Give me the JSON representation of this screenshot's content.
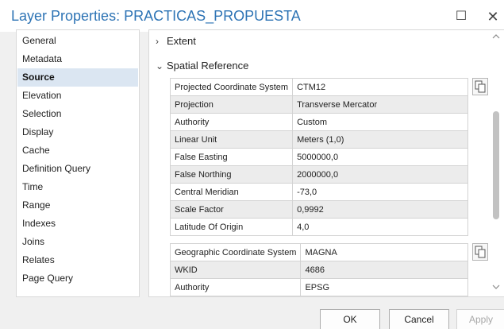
{
  "window": {
    "title": "Layer Properties: PRACTICAS_PROPUESTA",
    "max_glyph": "☐",
    "close_glyph": "✕"
  },
  "sidebar": {
    "items": [
      {
        "label": "General"
      },
      {
        "label": "Metadata"
      },
      {
        "label": "Source",
        "selected": true
      },
      {
        "label": "Elevation"
      },
      {
        "label": "Selection"
      },
      {
        "label": "Display"
      },
      {
        "label": "Cache"
      },
      {
        "label": "Definition Query"
      },
      {
        "label": "Time"
      },
      {
        "label": "Range"
      },
      {
        "label": "Indexes"
      },
      {
        "label": "Joins"
      },
      {
        "label": "Relates"
      },
      {
        "label": "Page Query"
      }
    ]
  },
  "main": {
    "extent": {
      "label": "Extent",
      "expanded": false,
      "chevron": "›"
    },
    "spatial_reference": {
      "label": "Spatial Reference",
      "expanded": true,
      "chevron": "⌄"
    },
    "projected": [
      {
        "key": "Projected Coordinate System",
        "value": "CTM12"
      },
      {
        "key": "Projection",
        "value": "Transverse Mercator"
      },
      {
        "key": "Authority",
        "value": "Custom"
      },
      {
        "key": "Linear Unit",
        "value": "Meters (1,0)"
      },
      {
        "key": "False Easting",
        "value": "5000000,0"
      },
      {
        "key": "False Northing",
        "value": "2000000,0"
      },
      {
        "key": "Central Meridian",
        "value": "-73,0"
      },
      {
        "key": "Scale Factor",
        "value": "0,9992"
      },
      {
        "key": "Latitude Of Origin",
        "value": "4,0"
      }
    ],
    "geographic": [
      {
        "key": "Geographic Coordinate System",
        "value": "MAGNA"
      },
      {
        "key": "WKID",
        "value": "4686"
      },
      {
        "key": "Authority",
        "value": "EPSG"
      }
    ],
    "icons": {
      "copy": "copy-icon",
      "scroll_up": "scroll-up-icon",
      "scroll_down": "scroll-down-icon"
    }
  },
  "footer": {
    "ok": "OK",
    "cancel": "Cancel",
    "apply": "Apply",
    "apply_enabled": false
  },
  "colors": {
    "title": "#2e74b5",
    "selected_bg": "#dbe6f2",
    "panel_bg": "#f0f0f0",
    "row_alt": "#ececec"
  }
}
